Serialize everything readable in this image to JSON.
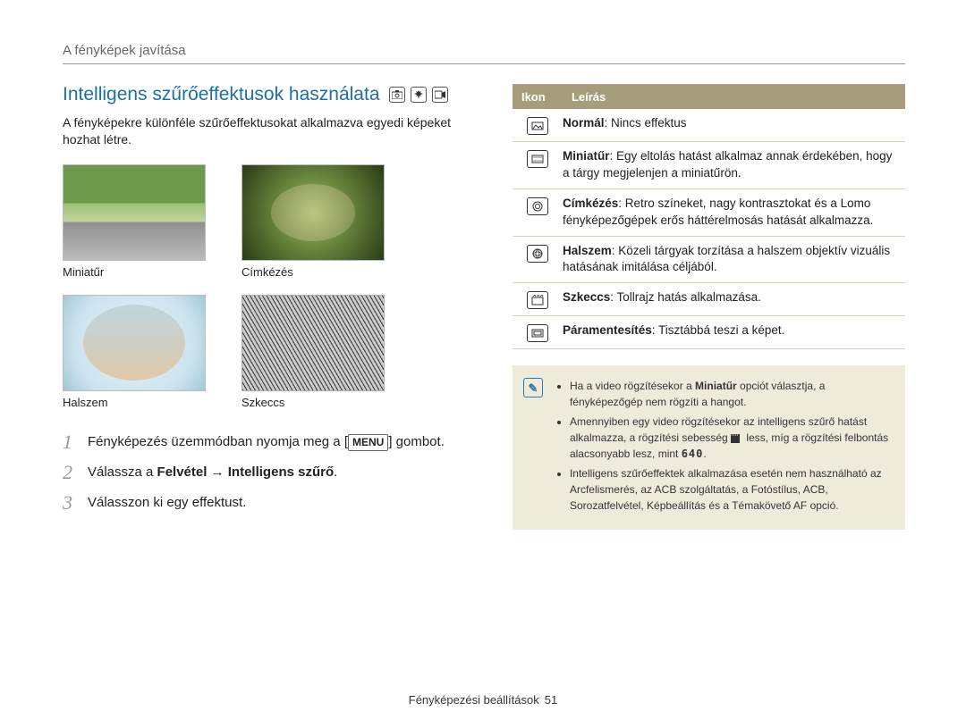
{
  "breadcrumb": "A fényképek javítása",
  "section_title": "Intelligens szűrőeffektusok használata",
  "intro": "A fényképekre különféle szűrőeffektusokat alkalmazva egyedi képeket hozhat létre.",
  "thumbs": {
    "miniature": "Miniatűr",
    "vignette": "Címkézés",
    "fisheye": "Halszem",
    "sketch": "Szkeccs"
  },
  "steps": {
    "s1_num": "1",
    "s1_a": "Fényképezés üzemmódban nyomja meg a [",
    "s1_menu": "MENU",
    "s1_b": "] gombot.",
    "s2_num": "2",
    "s2_a": "Válassza a ",
    "s2_b": "Felvétel",
    "s2_arrow": " → ",
    "s2_c": "Intelligens szűrő",
    "s2_d": ".",
    "s3_num": "3",
    "s3_text": "Válasszon ki egy effektust."
  },
  "table": {
    "h_icon": "Ikon",
    "h_desc": "Leírás",
    "rows": {
      "normal_b": "Normál",
      "normal_t": ": Nincs effektus",
      "mini_b": "Miniatűr",
      "mini_t": ": Egy eltolás hatást alkalmaz annak érdekében, hogy a tárgy megjelenjen a miniatűrön.",
      "vign_b": "Címkézés",
      "vign_t": ": Retro színeket, nagy kontrasztokat és a Lomo fényképezőgépek erős háttérelmosás hatását alkalmazza.",
      "fish_b": "Halszem",
      "fish_t": ": Közeli tárgyak torzítása a halszem objektív vizuális hatásának imitálása céljából.",
      "sketch_b": "Szkeccs",
      "sketch_t": ": Tollrajz hatás alkalmazása.",
      "defog_b": "Páramentesítés",
      "defog_t": ": Tisztábbá teszi a képet."
    }
  },
  "notes": {
    "n1_a": "Ha a video rögzítésekor a ",
    "n1_b": "Miniatűr",
    "n1_c": " opciót választja, a fényképezőgép nem rögzíti a hangot.",
    "n2_a": "Amennyiben egy video rögzítésekor az intelligens szűrő hatást alkalmazza, a rögzítési sebesség ",
    "n2_b": " less, míg a rögzítési felbontás alacsonyabb lesz, mint ",
    "n2_c": ".",
    "n3": "Intelligens szűrőeffektek alkalmazása esetén nem használható az Arcfelismerés, az ACB szolgáltatás, a Fotóstílus, ACB, Sorozatfelvétel, Képbeállítás és a Témakövető AF opció.",
    "res_640": "640"
  },
  "footer": {
    "section": "Fényképezési beállítások",
    "page": "51"
  }
}
